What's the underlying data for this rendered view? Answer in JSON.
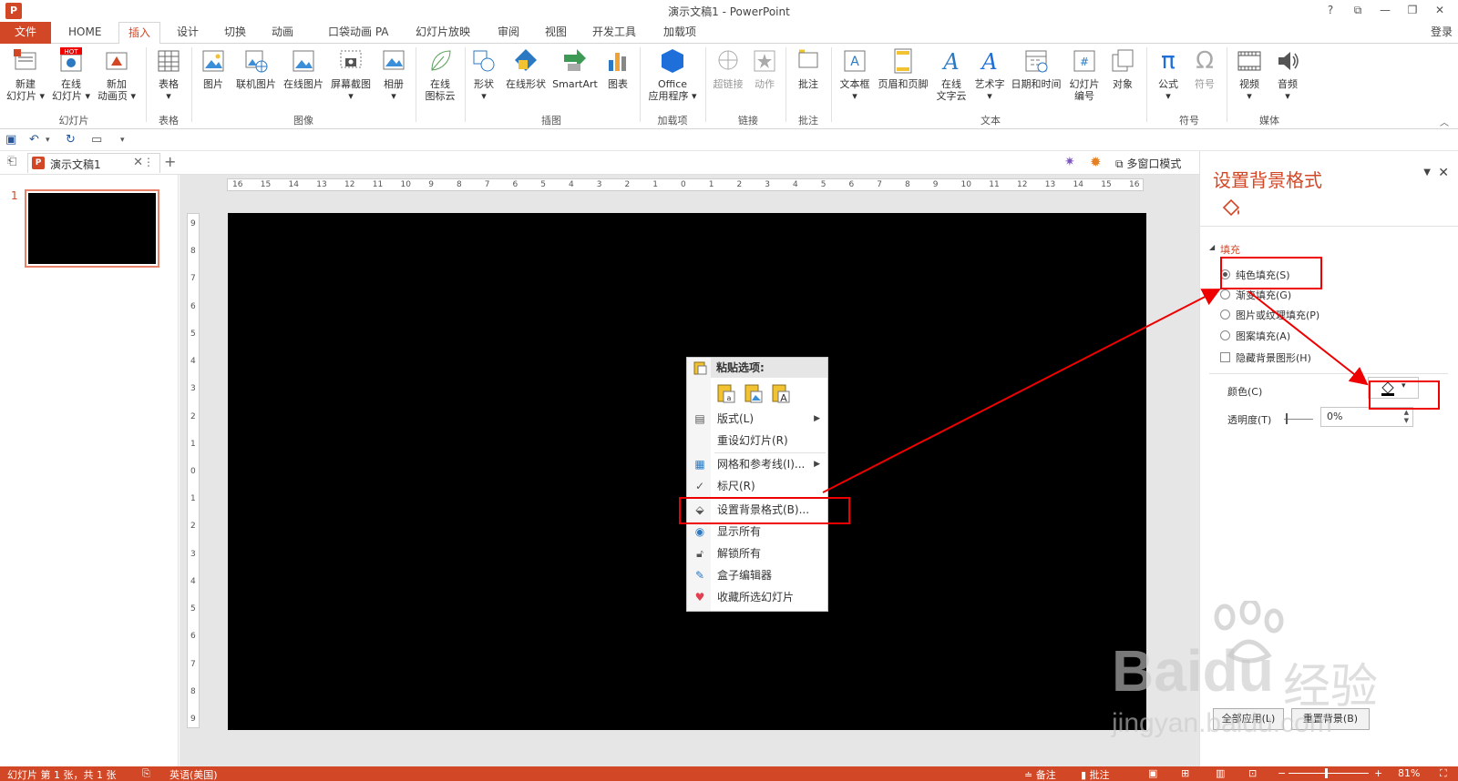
{
  "window": {
    "title": "演示文稿1 - PowerPoint",
    "app_icon": "P",
    "controls": [
      "?",
      "⧉",
      "—",
      "❐",
      "✕"
    ]
  },
  "tabs": {
    "file": "文件",
    "items": [
      "HOME",
      "插入",
      "设计",
      "切换",
      "动画",
      "口袋动画 PA",
      "幻灯片放映",
      "审阅",
      "视图",
      "开发工具",
      "加载项"
    ],
    "active": "插入",
    "login": "登录"
  },
  "ribbon": {
    "buttons": {
      "new_slide": "新建\n幻灯片 ▾",
      "online_slide": "在线\n幻灯片 ▾",
      "new_anim_page": "新加\n动画页 ▾",
      "table": "表格\n▾",
      "picture": "图片",
      "online_picture": "联机图片",
      "online_picture2": "在线图片",
      "screenshot": "屏幕截图\n▾",
      "album": "相册\n▾",
      "icon_cloud": "在线\n图标云",
      "shapes": "形状\n▾",
      "online_shapes": "在线形状",
      "smartart": "SmartArt",
      "chart": "图表",
      "office_apps": "Office\n应用程序 ▾",
      "hyperlink": "超链接",
      "action": "动作",
      "comment": "批注",
      "textbox": "文本框\n▾",
      "header_footer": "页眉和页脚",
      "online_text_cloud": "在线\n文字云",
      "wordart": "艺术字\n▾",
      "date_time": "日期和时间",
      "slide_number": "幻灯片\n编号",
      "object": "对象",
      "equation": "公式\n▾",
      "symbol": "符号",
      "video": "视频\n▾",
      "audio": "音频\n▾",
      "hot_badge": "HOT"
    },
    "groups": {
      "slides": "幻灯片",
      "tables": "表格",
      "images": "图像",
      "illustrations": "插图",
      "addins": "加载项",
      "links": "链接",
      "comments": "批注",
      "text": "文本",
      "symbols": "符号",
      "media": "媒体"
    },
    "collapse_icon": "chevron-up-icon"
  },
  "doc_tabs": {
    "doc_name": "演示文稿1",
    "close": "✕",
    "more": "⋮",
    "add": "+",
    "multi_window": "多窗口模式"
  },
  "thumbnails": {
    "slide_number": "1"
  },
  "ruler": {
    "horizontal": [
      "16",
      "15",
      "14",
      "13",
      "12",
      "11",
      "10",
      "9",
      "8",
      "7",
      "6",
      "5",
      "4",
      "3",
      "2",
      "1",
      "0",
      "1",
      "2",
      "3",
      "4",
      "5",
      "6",
      "7",
      "8",
      "9",
      "10",
      "11",
      "12",
      "13",
      "14",
      "15",
      "16"
    ],
    "vertical": [
      "9",
      "8",
      "7",
      "6",
      "5",
      "4",
      "3",
      "2",
      "1",
      "0",
      "1",
      "2",
      "3",
      "4",
      "5",
      "6",
      "7",
      "8",
      "9"
    ]
  },
  "context_menu": {
    "paste_header": "粘贴选项:",
    "items": [
      {
        "label": "版式(L)",
        "icon": "layout-icon",
        "submenu": true
      },
      {
        "label": "重设幻灯片(R)",
        "icon": "",
        "submenu": false
      },
      {
        "label": "网格和参考线(I)...",
        "icon": "grid-icon",
        "submenu": true
      },
      {
        "label": "标尺(R)",
        "icon": "check-icon",
        "submenu": false
      },
      {
        "label": "设置背景格式(B)...",
        "icon": "format-background-icon",
        "submenu": false
      },
      {
        "label": "显示所有",
        "icon": "eye-icon",
        "submenu": false
      },
      {
        "label": "解锁所有",
        "icon": "unlock-icon",
        "submenu": false
      },
      {
        "label": "盒子编辑器",
        "icon": "edit-icon",
        "submenu": false
      },
      {
        "label": "收藏所选幻灯片",
        "icon": "heart-icon",
        "submenu": false
      }
    ]
  },
  "format_pane": {
    "title": "设置背景格式",
    "section": "填充",
    "options": [
      {
        "label": "纯色填充(S)",
        "checked": true,
        "type": "radio"
      },
      {
        "label": "渐变填充(G)",
        "checked": false,
        "type": "radio"
      },
      {
        "label": "图片或纹理填充(P)",
        "checked": false,
        "type": "radio"
      },
      {
        "label": "图案填充(A)",
        "checked": false,
        "type": "radio"
      },
      {
        "label": "隐藏背景图形(H)",
        "checked": false,
        "type": "checkbox"
      }
    ],
    "color_label": "颜色(C)",
    "transparency_label": "透明度(T)",
    "transparency_value": "0%",
    "apply_all": "全部应用(L)",
    "reset_background": "重置背景(B)"
  },
  "status_bar": {
    "slide_info": "幻灯片 第 1 张，共 1 张",
    "language": "英语(美国)",
    "notes": "≐ 备注",
    "comments": "▮ 批注",
    "zoom": "81%"
  },
  "watermark": {
    "brand": "Baidu",
    "cn": "经验",
    "url": "jingyan.baidu.com"
  },
  "colors": {
    "accent": "#d24726",
    "annotation": "#e00000",
    "slide_bg": "#000000"
  }
}
